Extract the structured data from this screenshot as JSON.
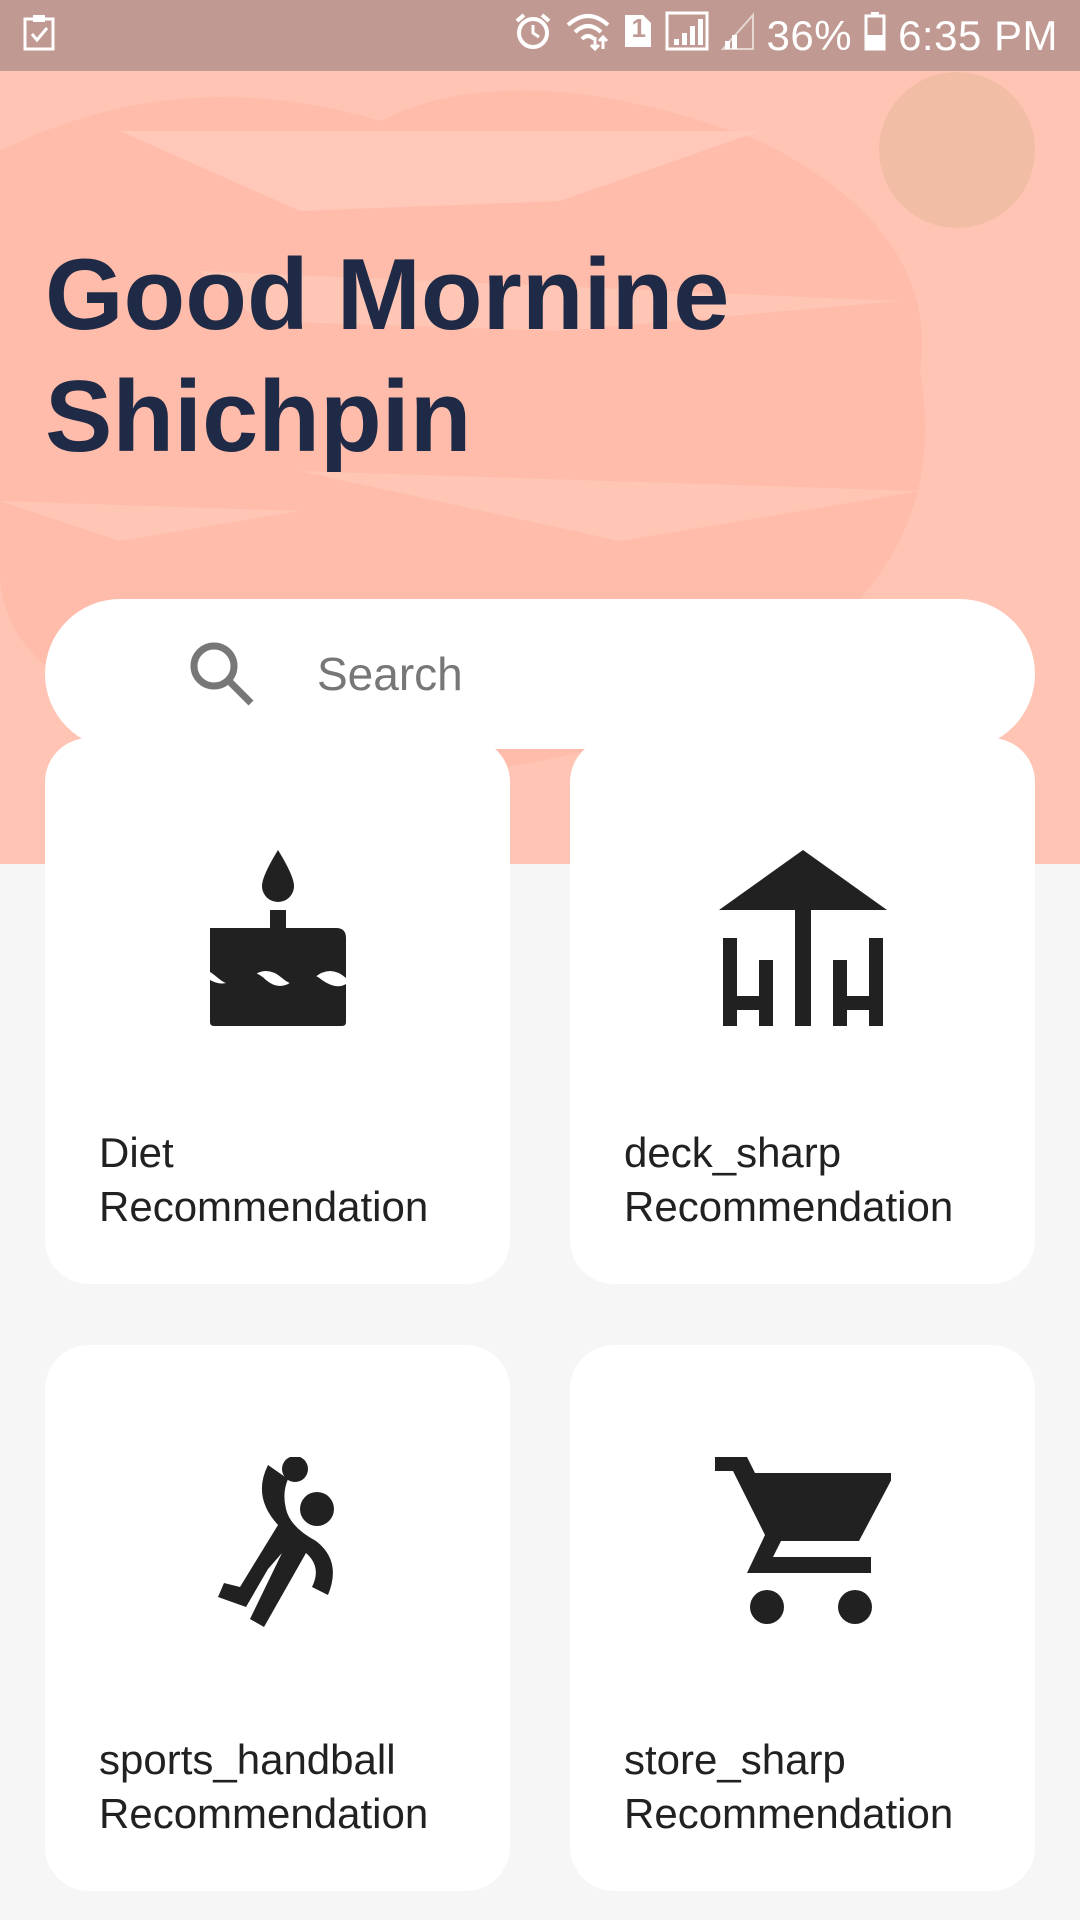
{
  "status_bar": {
    "icons": [
      "checklist-icon",
      "alarm-icon",
      "wifi-icon",
      "sim-1-icon",
      "signal-icon",
      "signal-weak-icon",
      "battery-icon"
    ],
    "sim_badge": "1",
    "battery": "36%",
    "time": "6:35 PM"
  },
  "header": {
    "title_line1": "Good Mornine",
    "title_line2": "Shichpin"
  },
  "search": {
    "placeholder": "Search"
  },
  "cards": [
    {
      "icon": "cake-icon",
      "line1": "Diet",
      "line2": "Recommendation"
    },
    {
      "icon": "deck-icon",
      "line1": "deck_sharp",
      "line2": "Recommendation"
    },
    {
      "icon": "sports-handball-icon",
      "line1": "sports_handball",
      "line2": "Recommendation"
    },
    {
      "icon": "shopping-cart-icon",
      "line1": "store_sharp",
      "line2": "Recommendation"
    }
  ],
  "colors": {
    "hero_bg": "#ffc4b3",
    "status_bar": "#c09a92",
    "title": "#1f2a47",
    "icon": "#212121",
    "page_bg": "#f6f6f6"
  }
}
